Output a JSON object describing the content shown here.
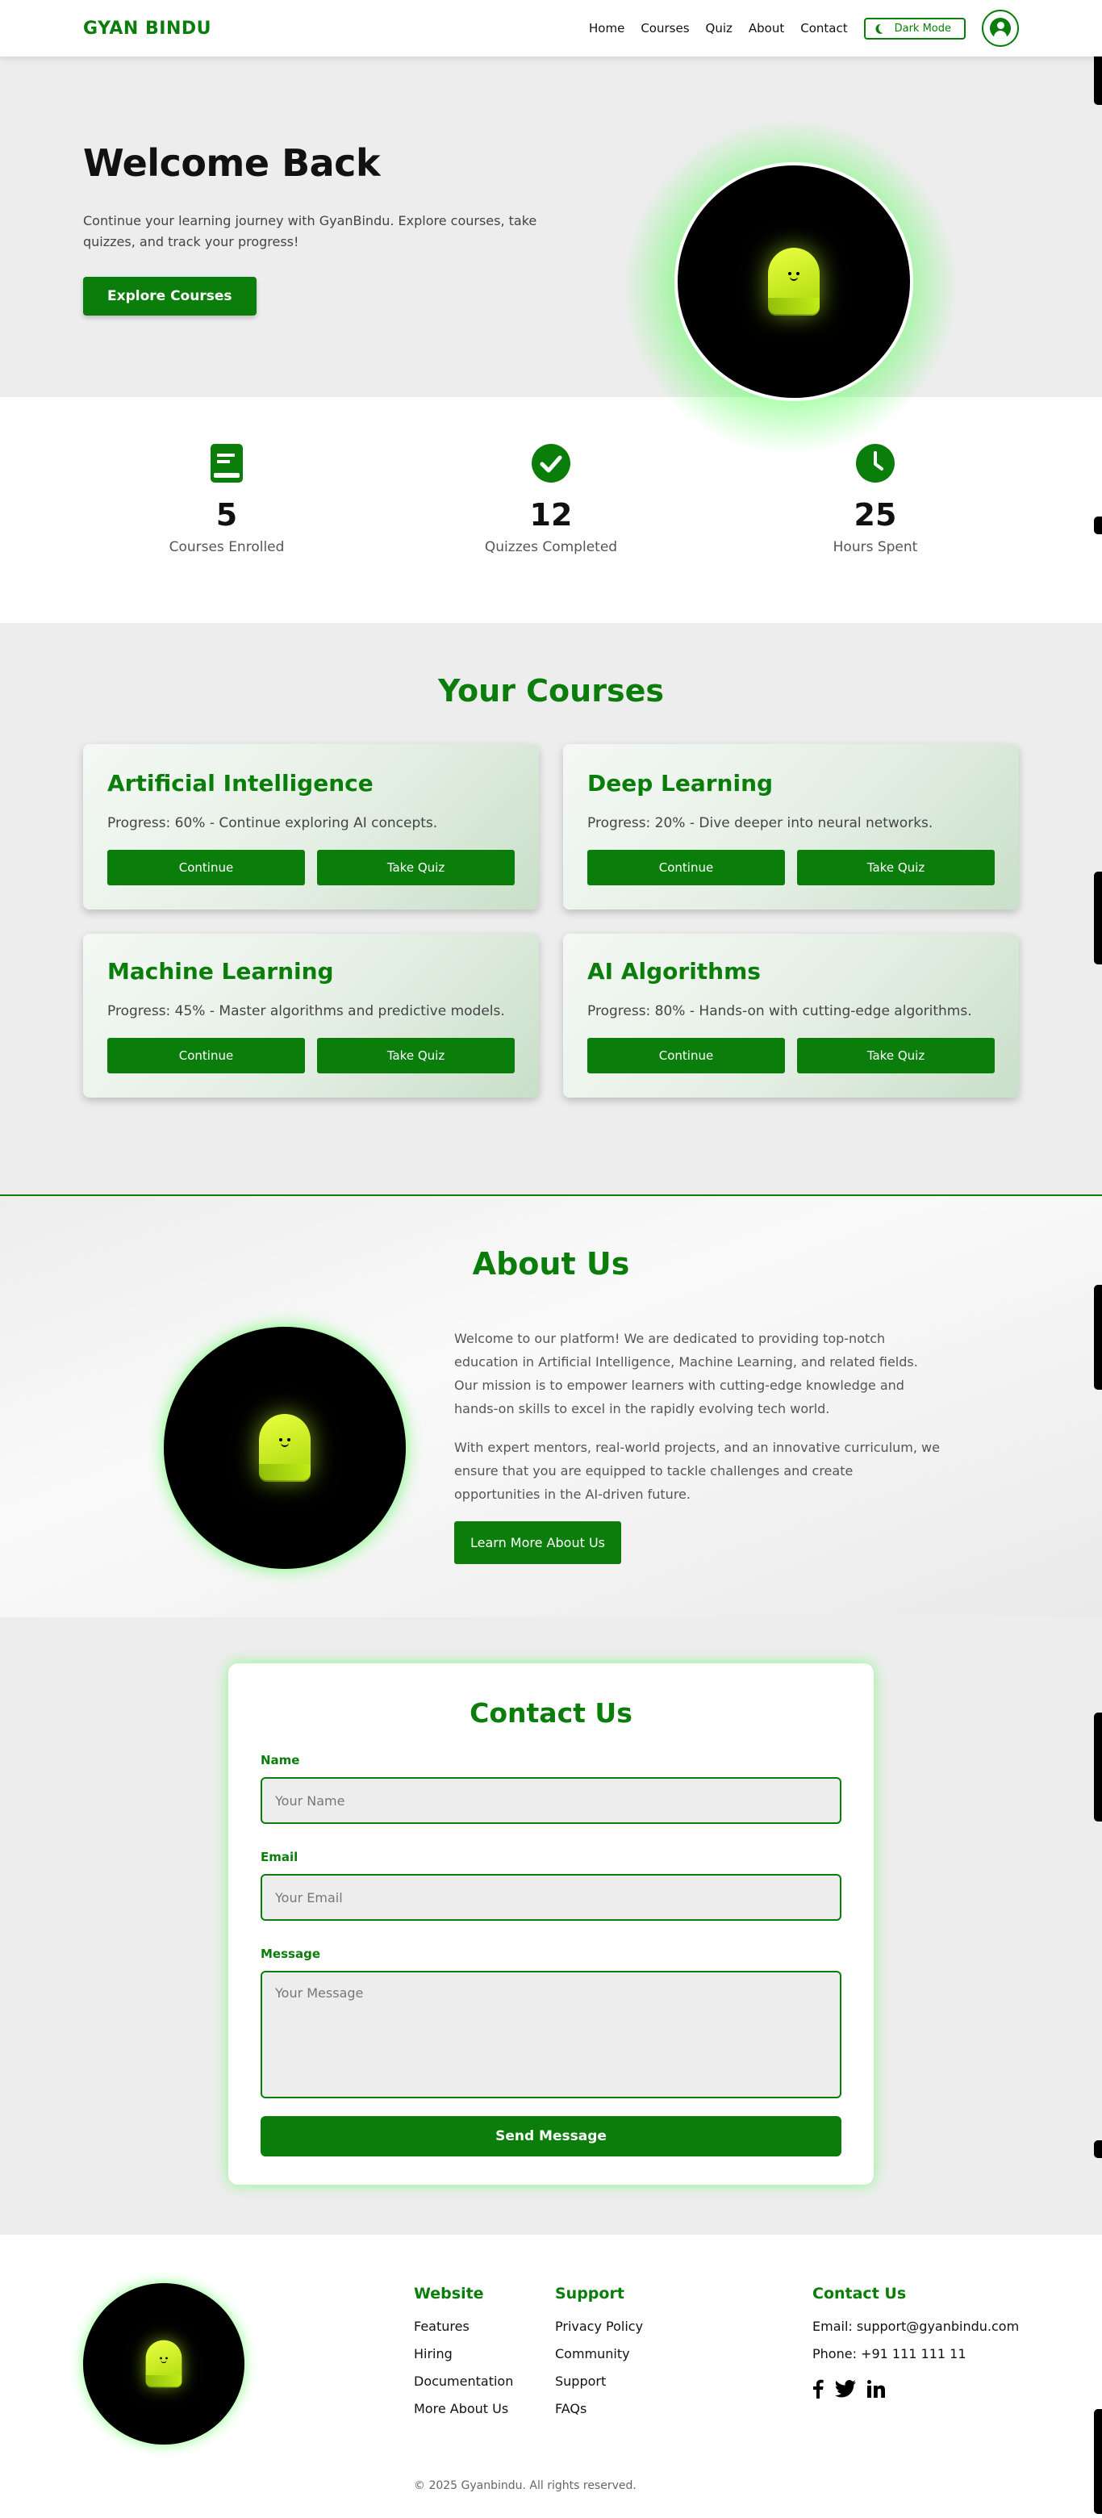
{
  "nav": {
    "logo": "GYAN BINDU",
    "links": [
      "Home",
      "Courses",
      "Quiz",
      "About",
      "Contact"
    ],
    "dark_mode_label": "Dark Mode"
  },
  "hero": {
    "title": "Welcome Back",
    "description": "Continue your learning journey with GyanBindu. Explore courses, take quizzes, and track your progress!",
    "button": "Explore Courses"
  },
  "stats": [
    {
      "value": "5",
      "label": "Courses Enrolled",
      "icon": "book-icon"
    },
    {
      "value": "12",
      "label": "Quizzes Completed",
      "icon": "check-circle-icon"
    },
    {
      "value": "25",
      "label": "Hours Spent",
      "icon": "clock-icon"
    }
  ],
  "courses": {
    "title": "Your Courses",
    "items": [
      {
        "title": "Artificial Intelligence",
        "progress": "Progress: 60% - Continue exploring AI concepts.",
        "continue": "Continue",
        "quiz": "Take Quiz"
      },
      {
        "title": "Deep Learning",
        "progress": "Progress: 20% - Dive deeper into neural networks.",
        "continue": "Continue",
        "quiz": "Take Quiz"
      },
      {
        "title": "Machine Learning",
        "progress": "Progress: 45% - Master algorithms and predictive models.",
        "continue": "Continue",
        "quiz": "Take Quiz"
      },
      {
        "title": "AI Algorithms",
        "progress": "Progress: 80% - Hands-on with cutting-edge algorithms.",
        "continue": "Continue",
        "quiz": "Take Quiz"
      }
    ]
  },
  "about": {
    "title": "About Us",
    "p1": "Welcome to our platform! We are dedicated to providing top-notch education in Artificial Intelligence, Machine Learning, and related fields. Our mission is to empower learners with cutting-edge knowledge and hands-on skills to excel in the rapidly evolving tech world.",
    "p2": "With expert mentors, real-world projects, and an innovative curriculum, we ensure that you are equipped to tackle challenges and create opportunities in the AI-driven future.",
    "button": "Learn More About Us"
  },
  "contact": {
    "title": "Contact Us",
    "name_label": "Name",
    "name_placeholder": "Your Name",
    "email_label": "Email",
    "email_placeholder": "Your Email",
    "message_label": "Message",
    "message_placeholder": "Your Message",
    "button": "Send Message"
  },
  "footer": {
    "website": {
      "title": "Website",
      "items": [
        "Features",
        "Hiring",
        "Documentation",
        "More About Us"
      ]
    },
    "support": {
      "title": "Support",
      "items": [
        "Privacy Policy",
        "Community",
        "Support",
        "FAQs"
      ]
    },
    "contact": {
      "title": "Contact Us",
      "email": "Email: support@gyanbindu.com",
      "phone": "Phone: +91 111 111 11"
    },
    "copyright": "© 2025 Gyanbindu. All rights reserved."
  },
  "colors": {
    "accent": "#0a7d0a",
    "glow": "#3cff3c",
    "ghost": "#d6f51e"
  }
}
